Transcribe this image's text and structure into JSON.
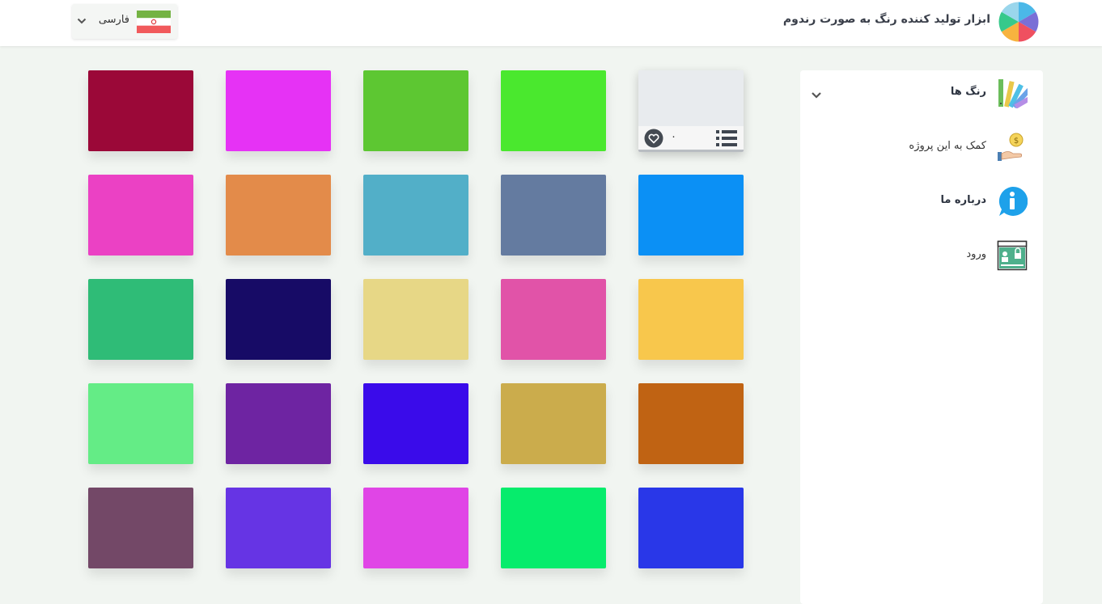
{
  "header": {
    "title": "ابزار تولید کننده رنگ به صورت رندوم",
    "language": "فارسی"
  },
  "sidebar": {
    "items": [
      {
        "label": "رنگ ها",
        "icon": "color-palette-icon"
      },
      {
        "label": "کمک به این پروژه",
        "icon": "donate-hand-icon"
      },
      {
        "label": "درباره ما",
        "icon": "info-icon"
      },
      {
        "label": "ورود",
        "icon": "login-icon"
      }
    ]
  },
  "card": {
    "likes": "۰",
    "color": "#e8ebee"
  },
  "colors": {
    "accent_blue": "#1ea1ea",
    "card_bg": "#e8ebee"
  },
  "swatches": [
    "#e9ebee",
    "#4ae82e",
    "#5dc732",
    "#e632f5",
    "#9b0838",
    "#0b90f5",
    "#647ba0",
    "#52afc8",
    "#e38b4a",
    "#eb41c4",
    "#f8c74c",
    "#e153a8",
    "#e7d786",
    "#170b66",
    "#2fbc77",
    "#c06313",
    "#cbac4c",
    "#3a0bea",
    "#6e24a2",
    "#64ec86",
    "#2937e8",
    "#06ec6c",
    "#e045e6",
    "#6634e4",
    "#734867"
  ]
}
